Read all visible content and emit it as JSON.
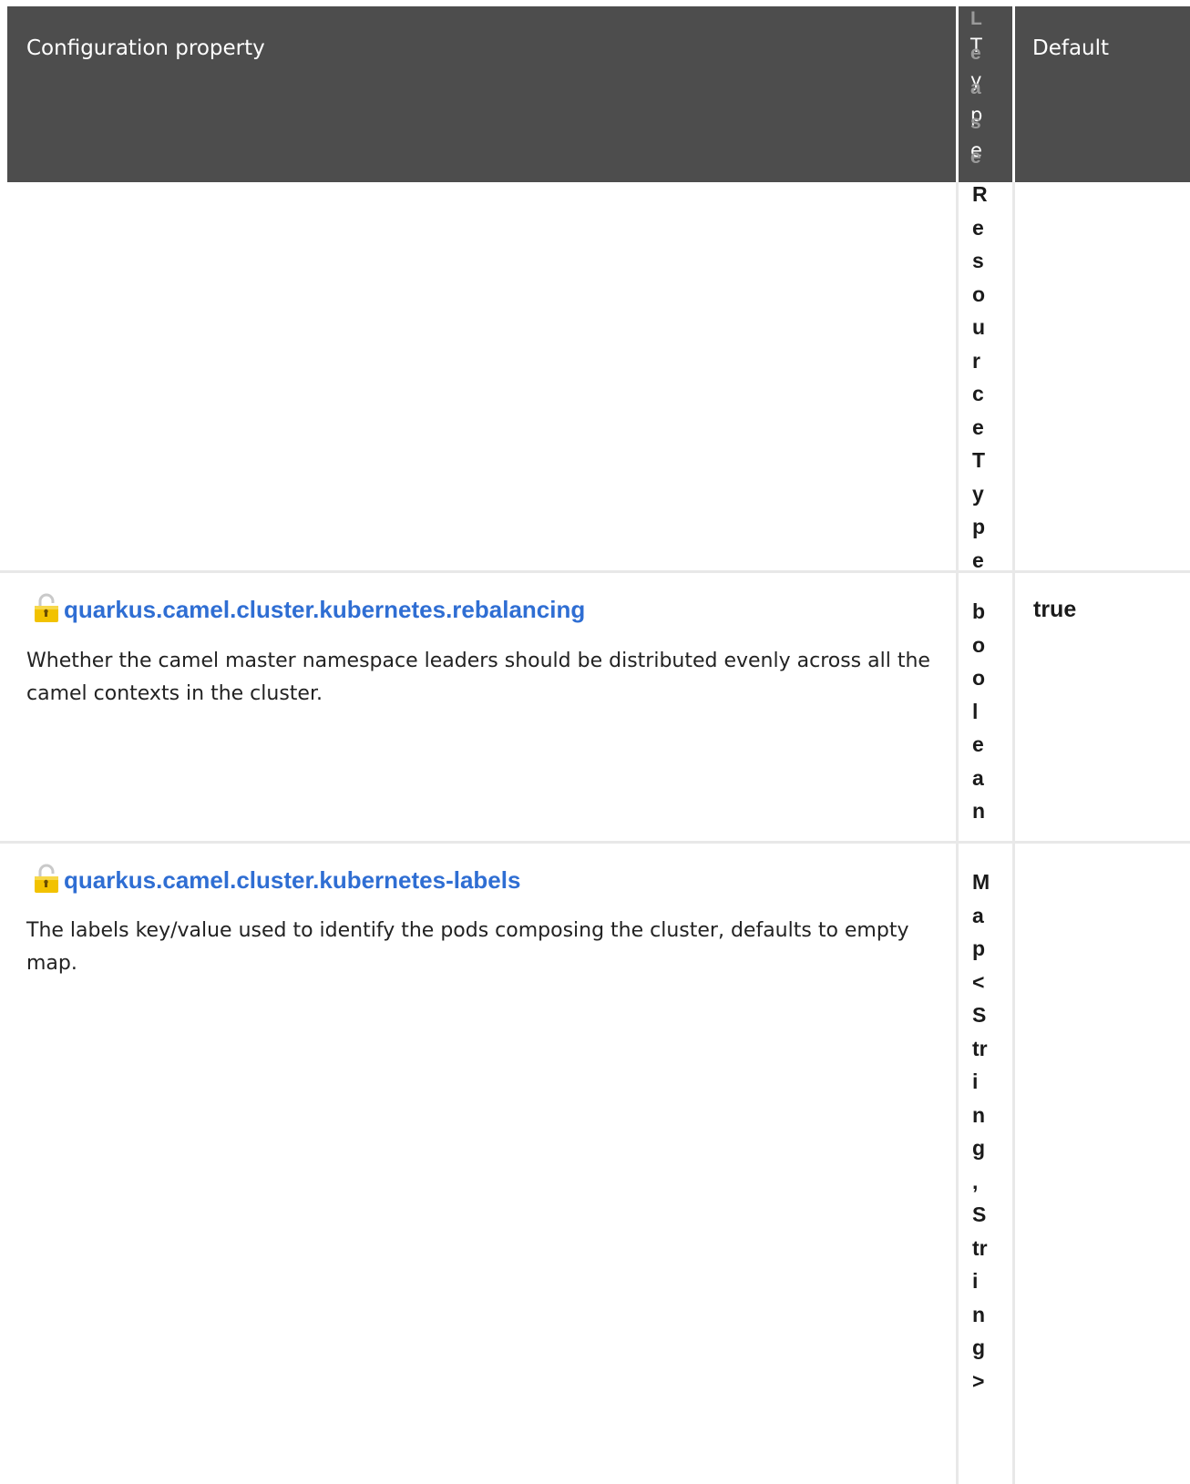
{
  "table": {
    "headers": {
      "property": "Configuration property",
      "type_letters": [
        "T",
        "y",
        "p",
        "e"
      ],
      "default": "Default"
    },
    "overflow_letters_header": [
      "L",
      "e",
      "a",
      "s",
      "e"
    ],
    "overflow_letters_body": [
      "R",
      "e",
      "s",
      "o",
      "u",
      "r",
      "c",
      "e",
      "T",
      "y",
      "p",
      "e"
    ],
    "rows": [
      {
        "name": "quarkus.camel.cluster.kubernetes.rebalancing",
        "description": "Whether the camel master namespace leaders should be distributed evenly across all the camel contexts in the cluster.",
        "type_letters": [
          "b",
          "o",
          "o",
          "l",
          "e",
          "a",
          "n"
        ],
        "default": "true",
        "lock_icon": "lock-icon"
      },
      {
        "name": "quarkus.camel.cluster.kubernetes-labels",
        "description": "The labels key/value used to identify the pods composing the cluster, defaults to empty map.",
        "type_letters": [
          "M",
          "a",
          "p",
          "<",
          "S",
          "tr",
          "i",
          "n",
          "g",
          ",",
          "S",
          "tr",
          "i",
          "n",
          "g",
          ">"
        ],
        "default": "",
        "lock_icon": "lock-icon"
      }
    ]
  },
  "colors": {
    "header_bg": "#4d4d4d",
    "link": "#2f6ed3",
    "lock_gold": "#f2c200"
  }
}
